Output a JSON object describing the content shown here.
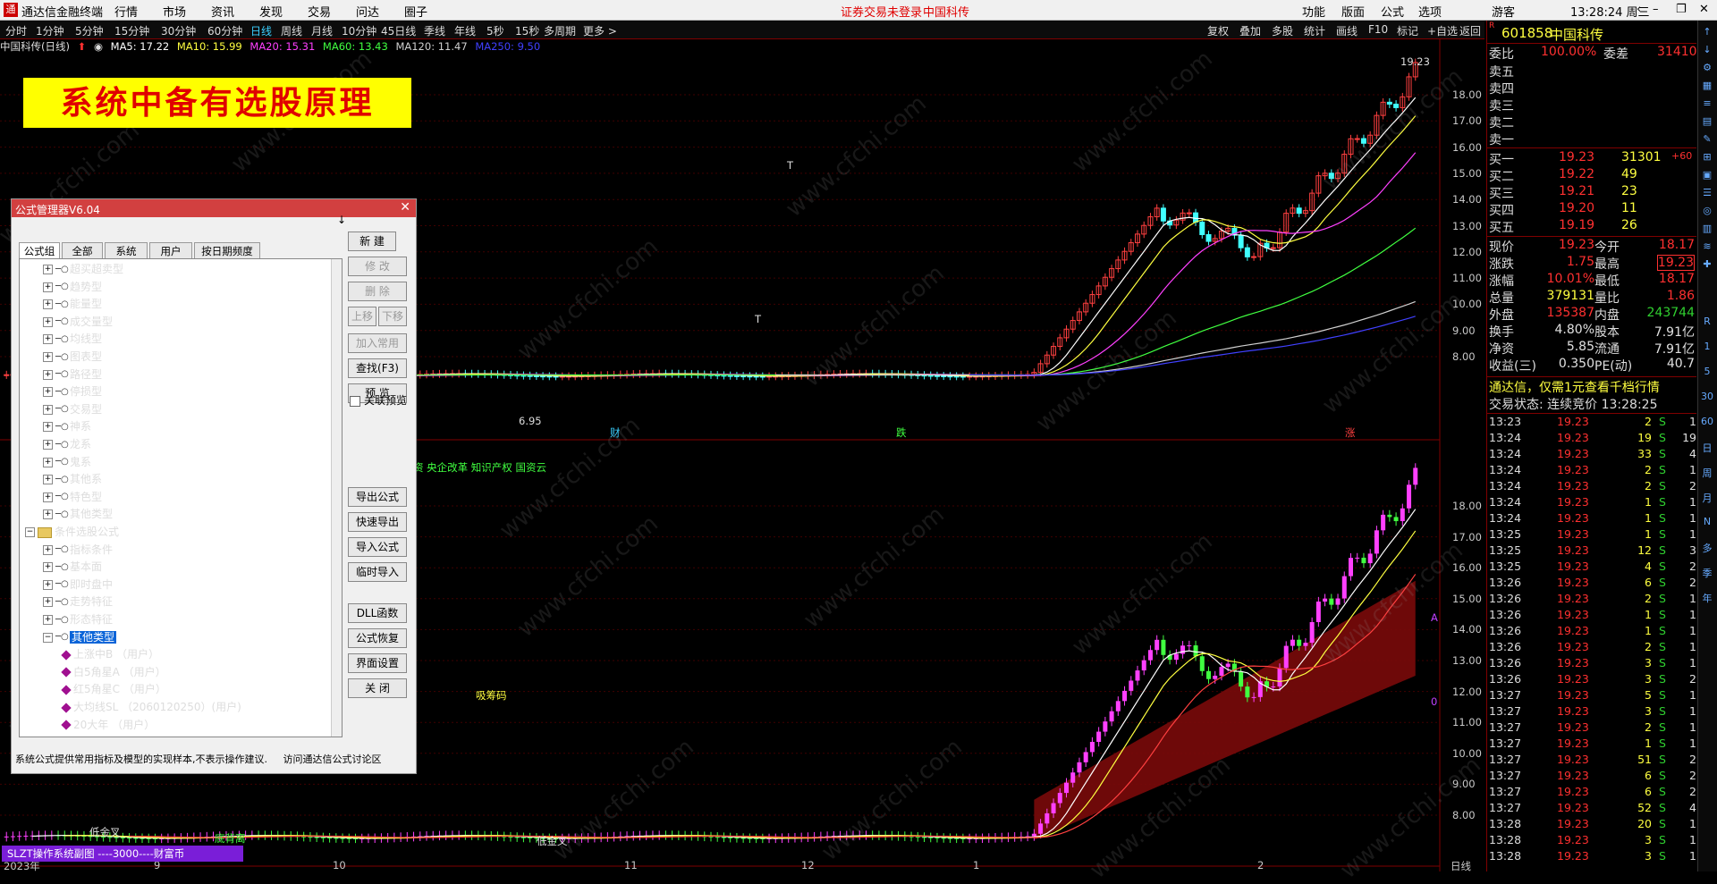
{
  "titlebar": {
    "app_name": "通达信金融终端",
    "menu": [
      "行情",
      "市场",
      "资讯",
      "发现",
      "交易",
      "问达",
      "圈子"
    ],
    "notice": "证券交易未登录",
    "stock_name": "中国科传",
    "right_menu": [
      "功能",
      "版面",
      "公式",
      "选项"
    ],
    "user": "游客",
    "clock": "13:28:24 周三"
  },
  "toolbar": {
    "periods": [
      "分时",
      "1分钟",
      "5分钟",
      "15分钟",
      "30分钟",
      "60分钟",
      "日线",
      "周线",
      "月线",
      "10分钟",
      "45日线",
      "季线",
      "年线",
      "5秒",
      "15秒",
      "多周期",
      "更多 >"
    ],
    "active": "日线",
    "right": [
      "复权",
      "叠加",
      "多股",
      "统计",
      "画线",
      "F10",
      "标记",
      "+自选",
      "返回"
    ]
  },
  "maline": {
    "name": "中国科传(日线)",
    "ma5": "MA5: 17.22",
    "ma10": "MA10: 15.99",
    "ma20": "MA20: 15.31",
    "ma60": "MA60: 13.43",
    "ma120": "MA120: 11.47",
    "ma250": "MA250: 9.50"
  },
  "banner": {
    "text": "系统中备有选股原理"
  },
  "watermark": "www.cfchi.com",
  "upper_chart": {
    "axis": [
      "18.00",
      "17.00",
      "16.00",
      "15.00",
      "14.00",
      "13.00",
      "12.00",
      "11.00",
      "10.00",
      "9.00",
      "8.00"
    ],
    "peak": "19.23",
    "low": "6.95",
    "labels": [
      "财",
      "跌",
      "涨"
    ],
    "marks": [
      "T",
      "T"
    ]
  },
  "lower_chart": {
    "concept_text": "资 央企改革 知识产权 国资云",
    "axis": [
      "18.00",
      "17.00",
      "16.00",
      "15.00",
      "14.00",
      "13.00",
      "12.00",
      "11.00",
      "10.00",
      "9.00",
      "8.00"
    ],
    "signals": [
      "吸筹码",
      "低金叉",
      "低金叉",
      "底背离"
    ],
    "right_marks": [
      "A",
      "0"
    ]
  },
  "date_axis": [
    "2023年",
    "9",
    "10",
    "11",
    "12",
    "1",
    "2",
    "日线"
  ],
  "dialog": {
    "title": "公式管理器V6.04",
    "tabs": [
      "公式组",
      "全部",
      "系统",
      "用户",
      "按日期频度"
    ],
    "active_tab": "公式组",
    "tree": [
      {
        "label": "超买超卖型",
        "level": 1,
        "kind": "group"
      },
      {
        "label": "趋势型",
        "level": 1,
        "kind": "group"
      },
      {
        "label": "能量型",
        "level": 1,
        "kind": "group"
      },
      {
        "label": "成交量型",
        "level": 1,
        "kind": "group"
      },
      {
        "label": "均线型",
        "level": 1,
        "kind": "group"
      },
      {
        "label": "图表型",
        "level": 1,
        "kind": "group"
      },
      {
        "label": "路径型",
        "level": 1,
        "kind": "group"
      },
      {
        "label": "停损型",
        "level": 1,
        "kind": "group"
      },
      {
        "label": "交易型",
        "level": 1,
        "kind": "group"
      },
      {
        "label": "神系",
        "level": 1,
        "kind": "group"
      },
      {
        "label": "龙系",
        "level": 1,
        "kind": "group"
      },
      {
        "label": "鬼系",
        "level": 1,
        "kind": "group"
      },
      {
        "label": "其他系",
        "level": 1,
        "kind": "group"
      },
      {
        "label": "特色型",
        "level": 1,
        "kind": "group"
      },
      {
        "label": "其他类型",
        "level": 1,
        "kind": "group"
      },
      {
        "label": "条件选股公式",
        "level": 0,
        "kind": "folder"
      },
      {
        "label": "指标条件",
        "level": 1,
        "kind": "group"
      },
      {
        "label": "基本面",
        "level": 1,
        "kind": "group"
      },
      {
        "label": "即时盘中",
        "level": 1,
        "kind": "group"
      },
      {
        "label": "走势特征",
        "level": 1,
        "kind": "group"
      },
      {
        "label": "形态特征",
        "level": 1,
        "kind": "group"
      },
      {
        "label": "其他类型",
        "level": 1,
        "kind": "group",
        "selected": true
      },
      {
        "label": "上涨中B （用户）",
        "level": 2,
        "kind": "formula"
      },
      {
        "label": "白5角星A （用户）",
        "level": 2,
        "kind": "formula"
      },
      {
        "label": "红5角星C （用户）",
        "level": 2,
        "kind": "formula"
      },
      {
        "label": "大均线SL （2060120250）(用户)",
        "level": 2,
        "kind": "formula"
      },
      {
        "label": "20大年 （用户）",
        "level": 2,
        "kind": "formula"
      }
    ],
    "buttons": [
      {
        "label": "新 建",
        "enabled": true
      },
      {
        "label": "修 改",
        "enabled": false
      },
      {
        "label": "删 除",
        "enabled": false
      },
      {
        "label": "上移",
        "enabled": false
      },
      {
        "label": "下移",
        "enabled": false
      },
      {
        "label": "加入常用",
        "enabled": false
      },
      {
        "label": "查找(F3)",
        "enabled": true
      },
      {
        "label": "预 览",
        "enabled": true
      },
      {
        "label": "关联预览",
        "enabled": true
      },
      {
        "label": "导出公式",
        "enabled": true
      },
      {
        "label": "快速导出",
        "enabled": true
      },
      {
        "label": "导入公式",
        "enabled": true
      },
      {
        "label": "临时导入",
        "enabled": true
      },
      {
        "label": "DLL函数",
        "enabled": true
      },
      {
        "label": "公式恢复",
        "enabled": true
      },
      {
        "label": "界面设置",
        "enabled": true
      },
      {
        "label": "关 闭",
        "enabled": true
      }
    ],
    "new_arrow": "↓",
    "footer_left": "系统公式提供常用指标及模型的实现样本,不表示操作建议.",
    "footer_link": "访问通达信公式讨论区"
  },
  "status_bar": {
    "text": "SLZT操作系统副图 ----3000----财富币"
  },
  "quote": {
    "code": "601858",
    "name": "中国科传",
    "ratio_label": "委比",
    "ratio": "100.00%",
    "diff_label": "委差",
    "diff": "31410",
    "asks": [
      {
        "label": "卖五",
        "price": "",
        "vol": ""
      },
      {
        "label": "卖四",
        "price": "",
        "vol": ""
      },
      {
        "label": "卖三",
        "price": "",
        "vol": ""
      },
      {
        "label": "卖二",
        "price": "",
        "vol": ""
      },
      {
        "label": "卖一",
        "price": "",
        "vol": ""
      }
    ],
    "bids": [
      {
        "label": "买一",
        "price": "19.23",
        "vol": "31301",
        "chg": "+60"
      },
      {
        "label": "买二",
        "price": "19.22",
        "vol": "49",
        "chg": ""
      },
      {
        "label": "买三",
        "price": "19.21",
        "vol": "23",
        "chg": ""
      },
      {
        "label": "买四",
        "price": "19.20",
        "vol": "11",
        "chg": ""
      },
      {
        "label": "买五",
        "price": "19.19",
        "vol": "26",
        "chg": ""
      }
    ],
    "stats": [
      {
        "l1": "现价",
        "v1": "19.23",
        "c1": "red",
        "l2": "今开",
        "v2": "18.17",
        "c2": "red"
      },
      {
        "l1": "涨跌",
        "v1": "1.75",
        "c1": "red",
        "l2": "最高",
        "v2": "19.23",
        "c2": "red"
      },
      {
        "l1": "涨幅",
        "v1": "10.01%",
        "c1": "red",
        "l2": "最低",
        "v2": "18.17",
        "c2": "red"
      },
      {
        "l1": "总量",
        "v1": "379131",
        "c1": "yel",
        "l2": "量比",
        "v2": "1.86",
        "c2": "red"
      },
      {
        "l1": "外盘",
        "v1": "135387",
        "c1": "red",
        "l2": "内盘",
        "v2": "243744",
        "c2": "grn"
      },
      {
        "l1": "换手",
        "v1": "4.80%",
        "c1": "wht",
        "l2": "股本",
        "v2": "7.91亿",
        "c2": "wht"
      },
      {
        "l1": "净资",
        "v1": "5.85",
        "c1": "wht",
        "l2": "流通",
        "v2": "7.91亿",
        "c2": "wht"
      },
      {
        "l1": "收益(三)",
        "v1": "0.350",
        "c1": "wht",
        "l2": "PE(动)",
        "v2": "40.7",
        "c2": "wht"
      }
    ],
    "promo": "通达信，仅需1元查看千档行情",
    "trade_state": "交易状态: 连续竞价 13:28:25",
    "ticks": [
      [
        "13:23",
        "19.23",
        "2",
        "S",
        "1"
      ],
      [
        "13:24",
        "19.23",
        "19",
        "S",
        "19"
      ],
      [
        "13:24",
        "19.23",
        "33",
        "S",
        "4"
      ],
      [
        "13:24",
        "19.23",
        "2",
        "S",
        "1"
      ],
      [
        "13:24",
        "19.23",
        "2",
        "S",
        "2"
      ],
      [
        "13:24",
        "19.23",
        "1",
        "S",
        "1"
      ],
      [
        "13:24",
        "19.23",
        "1",
        "S",
        "1"
      ],
      [
        "13:25",
        "19.23",
        "1",
        "S",
        "1"
      ],
      [
        "13:25",
        "19.23",
        "12",
        "S",
        "3"
      ],
      [
        "13:25",
        "19.23",
        "4",
        "S",
        "2"
      ],
      [
        "13:26",
        "19.23",
        "6",
        "S",
        "2"
      ],
      [
        "13:26",
        "19.23",
        "2",
        "S",
        "1"
      ],
      [
        "13:26",
        "19.23",
        "1",
        "S",
        "1"
      ],
      [
        "13:26",
        "19.23",
        "1",
        "S",
        "1"
      ],
      [
        "13:26",
        "19.23",
        "2",
        "S",
        "1"
      ],
      [
        "13:26",
        "19.23",
        "3",
        "S",
        "1"
      ],
      [
        "13:26",
        "19.23",
        "3",
        "S",
        "2"
      ],
      [
        "13:27",
        "19.23",
        "5",
        "S",
        "1"
      ],
      [
        "13:27",
        "19.23",
        "3",
        "S",
        "1"
      ],
      [
        "13:27",
        "19.23",
        "2",
        "S",
        "1"
      ],
      [
        "13:27",
        "19.23",
        "1",
        "S",
        "1"
      ],
      [
        "13:27",
        "19.23",
        "51",
        "S",
        "2"
      ],
      [
        "13:27",
        "19.23",
        "6",
        "S",
        "2"
      ],
      [
        "13:27",
        "19.23",
        "6",
        "S",
        "2"
      ],
      [
        "13:27",
        "19.23",
        "52",
        "S",
        "4"
      ],
      [
        "13:28",
        "19.23",
        "20",
        "S",
        "1"
      ],
      [
        "13:28",
        "19.23",
        "3",
        "S",
        "1"
      ],
      [
        "13:28",
        "19.23",
        "3",
        "S",
        "1"
      ]
    ]
  },
  "side_icons": [
    "R",
    "1",
    "5",
    "30",
    "60",
    "日",
    "周",
    "月",
    "N",
    "多",
    "季",
    "年"
  ]
}
